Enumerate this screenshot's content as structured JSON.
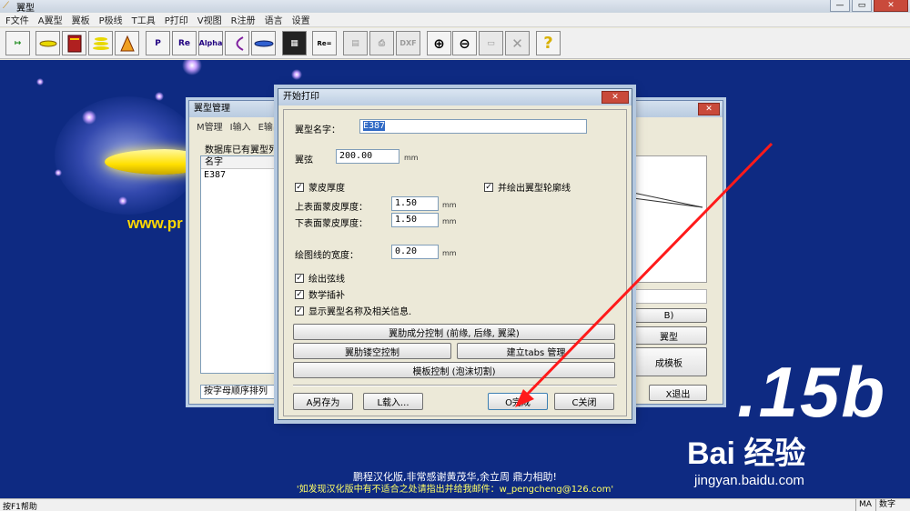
{
  "window": {
    "title": "翼型"
  },
  "menu": [
    "F文件",
    "A翼型",
    "翼板",
    "P极线",
    "T工具",
    "P打印",
    "V视图",
    "R注册",
    "语言",
    "设置"
  ],
  "toolbar": {
    "buttons": [
      {
        "name": "exit-icon",
        "label": "↦"
      },
      {
        "name": "airfoil-icon",
        "label": ""
      },
      {
        "name": "database-icon",
        "label": ""
      },
      {
        "name": "stack-icon",
        "label": ""
      },
      {
        "name": "polar-icon",
        "label": ""
      },
      {
        "name": "p-icon",
        "label": "P"
      },
      {
        "name": "re-icon",
        "label": "Re"
      },
      {
        "name": "alpha-icon",
        "label": "Alpha"
      },
      {
        "name": "curve-icon",
        "label": ""
      },
      {
        "name": "wing-icon",
        "label": ""
      },
      {
        "name": "display-icon",
        "label": ""
      },
      {
        "name": "calculator-icon",
        "label": "Re="
      },
      {
        "name": "print-preview-icon",
        "label": ""
      },
      {
        "name": "printer-icon",
        "label": ""
      },
      {
        "name": "dxf-icon",
        "label": "DXF"
      },
      {
        "name": "zoom-in-icon",
        "label": "⊕"
      },
      {
        "name": "zoom-out-icon",
        "label": "⊖"
      },
      {
        "name": "fit-icon",
        "label": ""
      },
      {
        "name": "clear-icon",
        "label": "✕"
      },
      {
        "name": "help-icon",
        "label": "?"
      }
    ]
  },
  "splash": {
    "website": "www.pr",
    "version": ".15b",
    "credit_line1": "鹏程汉化版,非常感谢黄茂华,余立周 鼎力相助!",
    "credit_line2": "'如发现汉化版中有不适合之处请指出并给我邮件：w_pengcheng@126.com'",
    "watermark_brand": "Bai 经验",
    "watermark_url": "jingyan.baidu.com"
  },
  "manager_dialog": {
    "title": "翼型管理",
    "menu": [
      "M管理",
      "I输入",
      "E输出"
    ],
    "db_title": "数据库已有翼型列表",
    "list_header": "名字",
    "list_items": [
      "E387"
    ],
    "sort_label": "按字母顺序排列",
    "side_buttons": [
      "B)",
      "翼型",
      "成模板"
    ],
    "exit_button": "X退出"
  },
  "print_dialog": {
    "title": "开始打印",
    "airfoil_name_label": "翼型名字：",
    "airfoil_name_value": "E387",
    "chord_label": "翼弦",
    "chord_value": "200.00",
    "unit": "mm",
    "skin_thickness_check": "蒙皮厚度",
    "outline_check": "并绘出翼型轮廓线",
    "upper_skin_label": "上表面蒙皮厚度：",
    "upper_skin_value": "1.50",
    "lower_skin_label": "下表面蒙皮厚度：",
    "lower_skin_value": "1.50",
    "line_width_label": "绘图线的宽度：",
    "line_width_value": "0.20",
    "chord_line_check": "绘出弦线",
    "interp_check": "数学插补",
    "show_name_check": "显示翼型名称及相关信息.",
    "btn_aux_parts": "翼肋成分控制 (前缘, 后缘, 翼梁)",
    "btn_lightening": "翼肋镂空控制",
    "btn_tabs": "建立tabs 管理",
    "btn_template": "模板控制 (泡沫切割)",
    "btn_save_as": "A另存为",
    "btn_load": "L载入...",
    "btn_done": "O完成",
    "btn_close": "C关闭"
  },
  "statusbar": {
    "help": "按F1帮助",
    "ma": "MA",
    "num": "数字"
  },
  "colors": {
    "workspace": "#0e2a82",
    "arrow": "#ff1a1a",
    "selection": "#316ac5"
  }
}
